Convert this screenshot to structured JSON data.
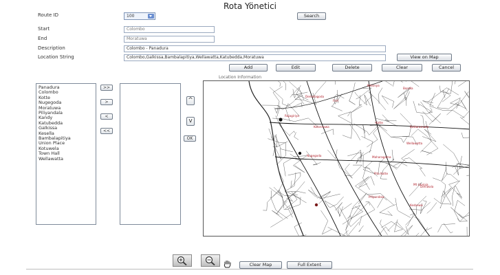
{
  "page": {
    "title": "Rota Yönetici"
  },
  "form": {
    "route_id_label": "Route ID",
    "route_id_value": "100",
    "search_label": "Search",
    "start_label": "Start",
    "start_value": "Colombo",
    "end_label": "End",
    "end_value": "Moratuwa",
    "description_label": "Description",
    "description_value": "Colombo - Panadura",
    "location_label": "Location String",
    "location_value": "Colombo,Galkissa,Bambalapitiya,Wellawatta,Katubedda,Moratuwa",
    "view_map_label": "View on Map"
  },
  "actions": {
    "add": "Add",
    "edit": "Edit",
    "delete": "Delete",
    "clear": "Clear",
    "cancel": "Cancel"
  },
  "lists": {
    "available": [
      "Panadura",
      "Colombo",
      "Kotte",
      "Nugegoda",
      "Moratuwa",
      "Piliyandala",
      "Kandy",
      "Katubedda",
      "Galkissa",
      "Kesella",
      "Bambalapitiya",
      "Union Place",
      "Kotuwela",
      "Town Hall",
      "Wellawatta"
    ],
    "transfer": {
      "all_right": ">>",
      "one_right": ">",
      "one_left": "<",
      "all_left": "<<"
    },
    "order": {
      "up": "^",
      "down": "v",
      "ok": "OK"
    }
  },
  "map": {
    "caption": "Location Information",
    "places": [
      "Kelaniya",
      "Dematagoda",
      "Fort",
      "Borella",
      "Rajagiriya",
      "Kolonnawa",
      "Kotte",
      "Battaramulla",
      "Wellawatta",
      "Nugegoda",
      "Maharagama",
      "Pita Kotte",
      "Dehiwala",
      "Piliyandala",
      "Kesbewa",
      "Mt Lavinia"
    ]
  },
  "tools": {
    "zoom_in_icon": "magnifier-plus-icon",
    "zoom_out_icon": "magnifier-minus-icon",
    "pan_icon": "hand-icon",
    "clear_map": "Clear Map",
    "full_extent": "Full Extent"
  }
}
